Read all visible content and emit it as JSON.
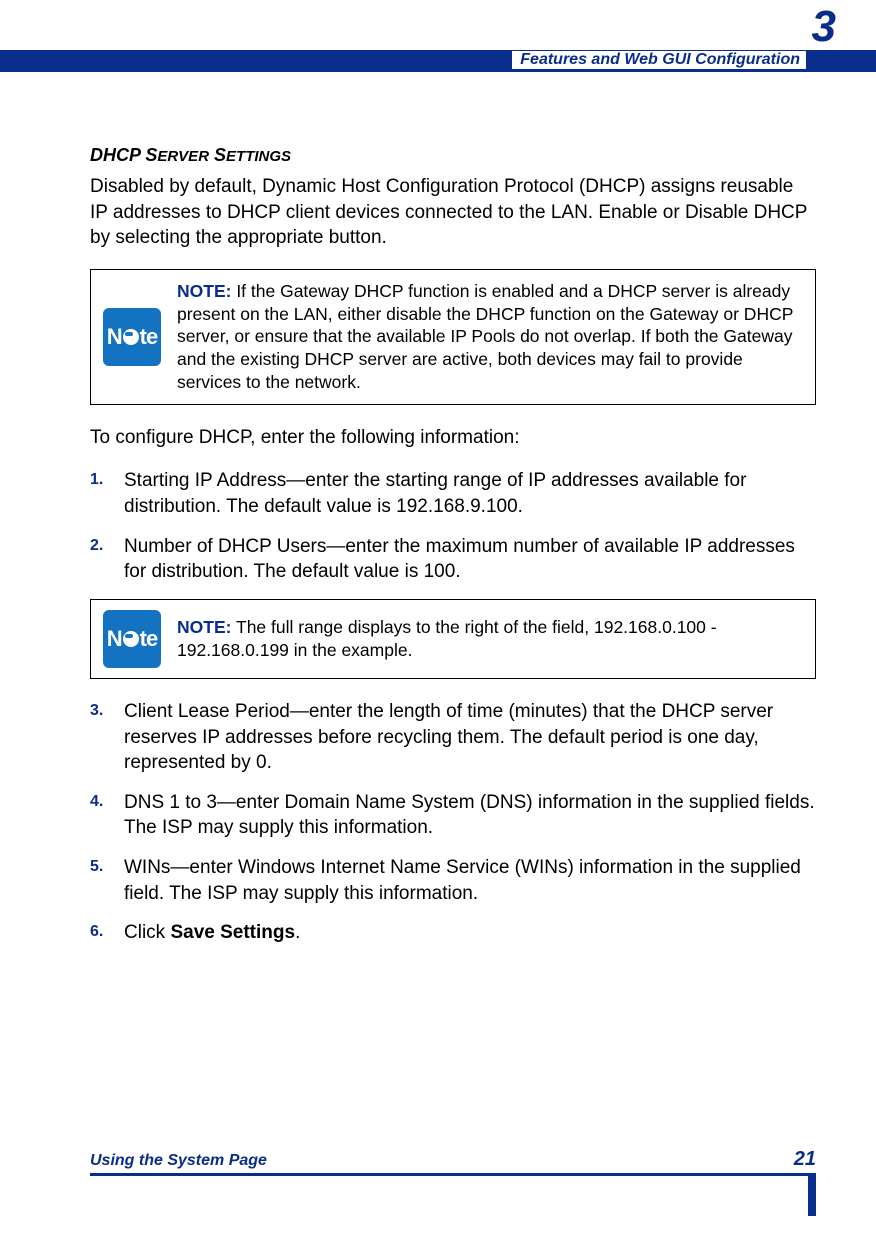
{
  "chapter_number": "3",
  "header_title": "Features and Web GUI Configuration",
  "section_heading_prefix": "DHCP S",
  "section_heading_sc": "ERVER",
  "section_heading_mid": " S",
  "section_heading_sc2": "ETTINGS",
  "intro_para": "Disabled by default, Dynamic Host Configuration Protocol (DHCP) assigns reusable IP addresses to DHCP client devices connected to the LAN. Enable or Disable DHCP by selecting the appropriate button.",
  "note1": {
    "label": "NOTE:",
    "text": " If the Gateway DHCP function is enabled and a DHCP server is already present on the LAN, either disable the DHCP function on the Gateway or DHCP server, or ensure that the available IP Pools do not overlap. If both the Gateway and the existing DHCP server are active, both devices may fail to provide services to the network."
  },
  "configure_para": "To configure DHCP, enter the following information:",
  "steps": [
    "Starting IP Address—enter the starting range of IP addresses available for distribution. The default value is 192.168.9.100.",
    "Number of DHCP Users—enter the maximum number of available IP addresses for distribution. The default value is 100."
  ],
  "note2": {
    "label": "NOTE:",
    "text": " The full range displays to the right of the field, 192.168.0.100 - 192.168.0.199 in the example."
  },
  "steps2": [
    " Client Lease Period—enter the length of time (minutes) that the DHCP server reserves IP addresses before recycling them. The default period is one day, represented by 0.",
    "DNS 1 to 3—enter Domain Name System (DNS) information in the supplied fields. The ISP may supply this information.",
    "WINs—enter Windows Internet Name Service (WINs) information in the supplied field. The ISP may supply this information."
  ],
  "step6_prefix": "Click ",
  "step6_bold": "Save Settings",
  "step6_suffix": ".",
  "footer": {
    "left": "Using the System Page",
    "right": "21"
  },
  "note_icon_letters": {
    "n": "N",
    "te": "te"
  }
}
